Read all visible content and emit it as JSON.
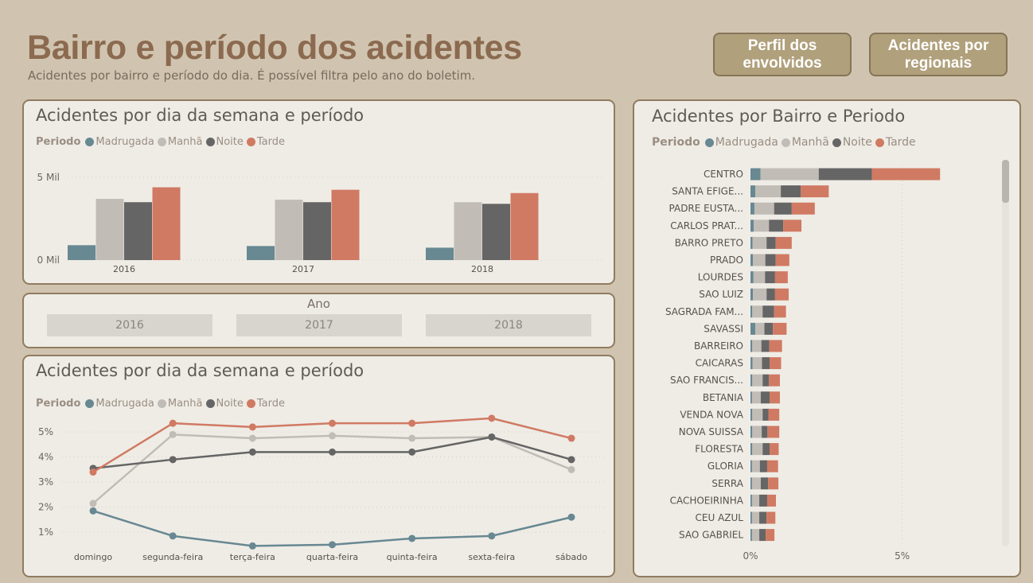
{
  "header": {
    "title": "Bairro e período dos acidentes",
    "subtitle": "Acidentes por bairro e período do dia. É possível filtra pelo ano do boletim."
  },
  "nav": {
    "btn1": "Perfil dos envolvidos",
    "btn2": "Acidentes por regionais"
  },
  "legend": {
    "label": "Periodo",
    "items": [
      "Madrugada",
      "Manhã",
      "Noite",
      "Tarde"
    ]
  },
  "colors": {
    "Madrugada": "#688892",
    "Manhã": "#c1bcb6",
    "Noite": "#656565",
    "Tarde": "#d07a63"
  },
  "slicer": {
    "title": "Ano",
    "options": [
      "2016",
      "2017",
      "2018"
    ]
  },
  "chart_data": [
    {
      "id": "bar-year",
      "type": "bar",
      "title": "Acidentes por dia da semana e período",
      "categories": [
        "2016",
        "2017",
        "2018"
      ],
      "series": [
        {
          "name": "Madrugada",
          "values": [
            0.9,
            0.85,
            0.75
          ]
        },
        {
          "name": "Manhã",
          "values": [
            3.7,
            3.65,
            3.5
          ]
        },
        {
          "name": "Noite",
          "values": [
            3.5,
            3.5,
            3.4
          ]
        },
        {
          "name": "Tarde",
          "values": [
            4.4,
            4.25,
            4.05
          ]
        }
      ],
      "yticks": [
        {
          "value": 0,
          "label": "0 Mil"
        },
        {
          "value": 5,
          "label": "5 Mil"
        }
      ],
      "ylim": [
        0,
        5
      ],
      "grid": true
    },
    {
      "id": "line-weekday",
      "type": "line",
      "title": "Acidentes por dia da semana e período",
      "categories": [
        "domingo",
        "segunda-feira",
        "terça-feira",
        "quarta-feira",
        "quinta-feira",
        "sexta-feira",
        "sábado"
      ],
      "series": [
        {
          "name": "Madrugada",
          "values": [
            1.85,
            0.85,
            0.45,
            0.5,
            0.75,
            0.85,
            1.6
          ]
        },
        {
          "name": "Manhã",
          "values": [
            2.15,
            4.9,
            4.75,
            4.85,
            4.75,
            4.8,
            3.5
          ]
        },
        {
          "name": "Noite",
          "values": [
            3.55,
            3.9,
            4.2,
            4.2,
            4.2,
            4.8,
            3.9
          ]
        },
        {
          "name": "Tarde",
          "values": [
            3.4,
            5.35,
            5.2,
            5.35,
            5.35,
            5.55,
            4.75
          ]
        }
      ],
      "yticks": [
        {
          "value": 1,
          "label": "1%"
        },
        {
          "value": 2,
          "label": "2%"
        },
        {
          "value": 3,
          "label": "3%"
        },
        {
          "value": 4,
          "label": "4%"
        },
        {
          "value": 5,
          "label": "5%"
        }
      ],
      "ylim": [
        0.4,
        5.8
      ],
      "grid": true
    },
    {
      "id": "hbar-bairro",
      "type": "bar",
      "orientation": "horizontal",
      "stacked": true,
      "title": "Acidentes por Bairro e Periodo",
      "categories": [
        "CENTRO",
        "SANTA EFIGE...",
        "PADRE EUSTA...",
        "CARLOS PRAT...",
        "BARRO PRETO",
        "PRADO",
        "LOURDES",
        "SAO LUIZ",
        "SAGRADA FAM...",
        "SAVASSI",
        "BARREIRO",
        "CAICARAS",
        "SAO FRANCIS...",
        "BETANIA",
        "VENDA NOVA",
        "NOVA SUISSA",
        "FLORESTA",
        "GLORIA",
        "SERRA",
        "CACHOEIRINHA",
        "CEU AZUL",
        "SAO GABRIEL"
      ],
      "series": [
        {
          "name": "Madrugada",
          "values": [
            0.33,
            0.16,
            0.13,
            0.11,
            0.07,
            0.08,
            0.1,
            0.08,
            0.06,
            0.16,
            0.06,
            0.07,
            0.06,
            0.05,
            0.06,
            0.06,
            0.06,
            0.05,
            0.05,
            0.05,
            0.05,
            0.05
          ]
        },
        {
          "name": "Manhã",
          "values": [
            1.92,
            0.84,
            0.65,
            0.5,
            0.46,
            0.41,
            0.38,
            0.45,
            0.34,
            0.3,
            0.3,
            0.31,
            0.34,
            0.29,
            0.34,
            0.31,
            0.34,
            0.26,
            0.29,
            0.24,
            0.24,
            0.24
          ]
        },
        {
          "name": "Noite",
          "values": [
            1.75,
            0.66,
            0.58,
            0.47,
            0.3,
            0.34,
            0.33,
            0.28,
            0.38,
            0.28,
            0.26,
            0.25,
            0.21,
            0.29,
            0.19,
            0.19,
            0.23,
            0.24,
            0.24,
            0.26,
            0.24,
            0.21
          ]
        },
        {
          "name": "Tarde",
          "values": [
            2.25,
            0.92,
            0.76,
            0.6,
            0.53,
            0.45,
            0.42,
            0.45,
            0.39,
            0.45,
            0.42,
            0.38,
            0.36,
            0.34,
            0.36,
            0.39,
            0.3,
            0.36,
            0.34,
            0.29,
            0.29,
            0.29
          ]
        }
      ],
      "xticks": [
        {
          "value": 0,
          "label": "0%"
        },
        {
          "value": 5,
          "label": "5%"
        }
      ],
      "xlim": [
        0,
        8.5
      ],
      "grid": true
    }
  ]
}
